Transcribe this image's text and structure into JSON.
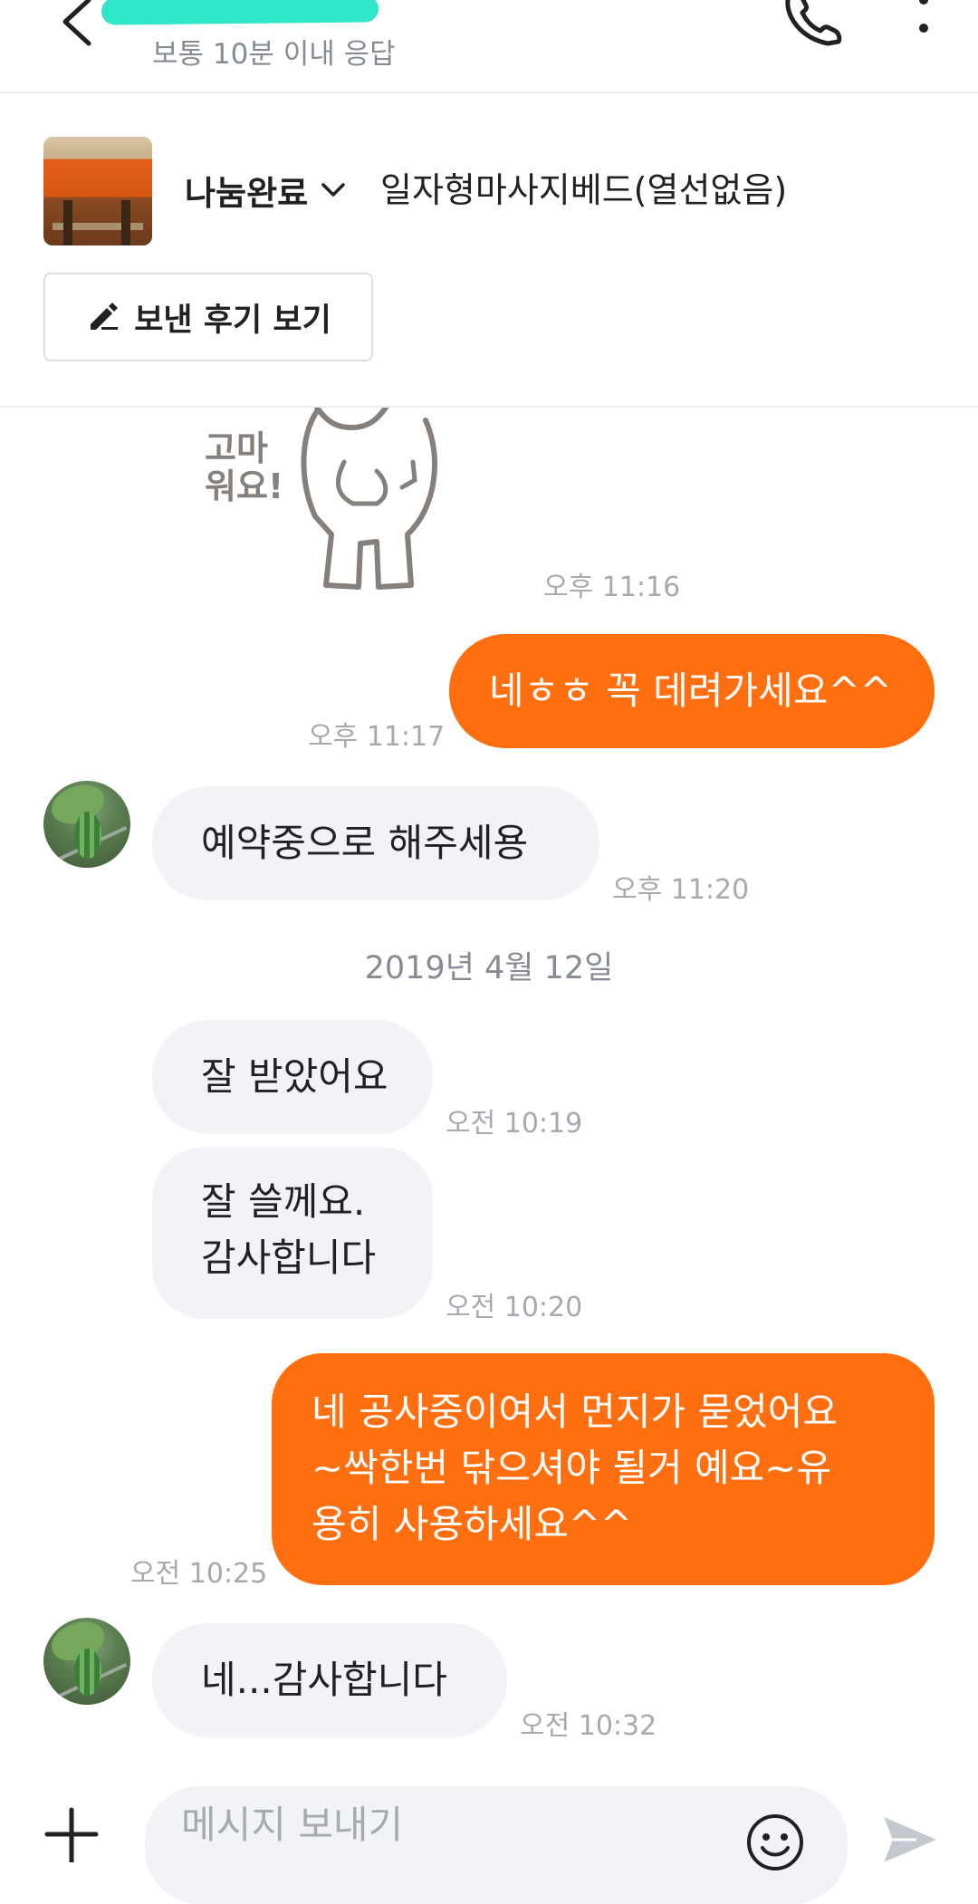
{
  "header": {
    "status": "보통 10분 이내 응답"
  },
  "product": {
    "status_label": "나눔완료",
    "title": "일자형마사지베드(열선없음)",
    "review_button_label": "보낸 후기 보기"
  },
  "sticker": {
    "text": [
      "고마",
      "워요!"
    ],
    "time": "오후 11:16"
  },
  "messages": [
    {
      "sender": "me",
      "text": "네ㅎㅎ 꼭 데려가세요^^",
      "time": "오후 11:17"
    },
    {
      "sender": "other",
      "text": "예약중으로 해주세용",
      "time": "오후 11:20"
    },
    {
      "sender": "other",
      "text": "잘 받았어요",
      "time": "오전 10:19"
    },
    {
      "sender": "other",
      "text": "잘 쓸께요.\n감사합니다",
      "time": "오전 10:20"
    },
    {
      "sender": "me",
      "text": "네 공사중이여서 먼지가 묻었어요\n~싹한번 닦으셔야 될거 예요~유\n용히 사용하세요^^",
      "time": "오전 10:25"
    },
    {
      "sender": "other",
      "text": "네...감사합니다",
      "time": "오전 10:32"
    }
  ],
  "date_divider": "2019년 4월 12일",
  "input": {
    "placeholder": "메시지 보내기"
  },
  "colors": {
    "brand_orange": "#ff6f0f",
    "incoming_bubble": "#f2f3f6",
    "redaction": "#30e6c8"
  },
  "icons": [
    "back-arrow-icon",
    "phone-icon",
    "more-vertical-icon",
    "chevron-down-icon",
    "pencil-icon",
    "plus-icon",
    "emoji-icon",
    "send-icon"
  ]
}
